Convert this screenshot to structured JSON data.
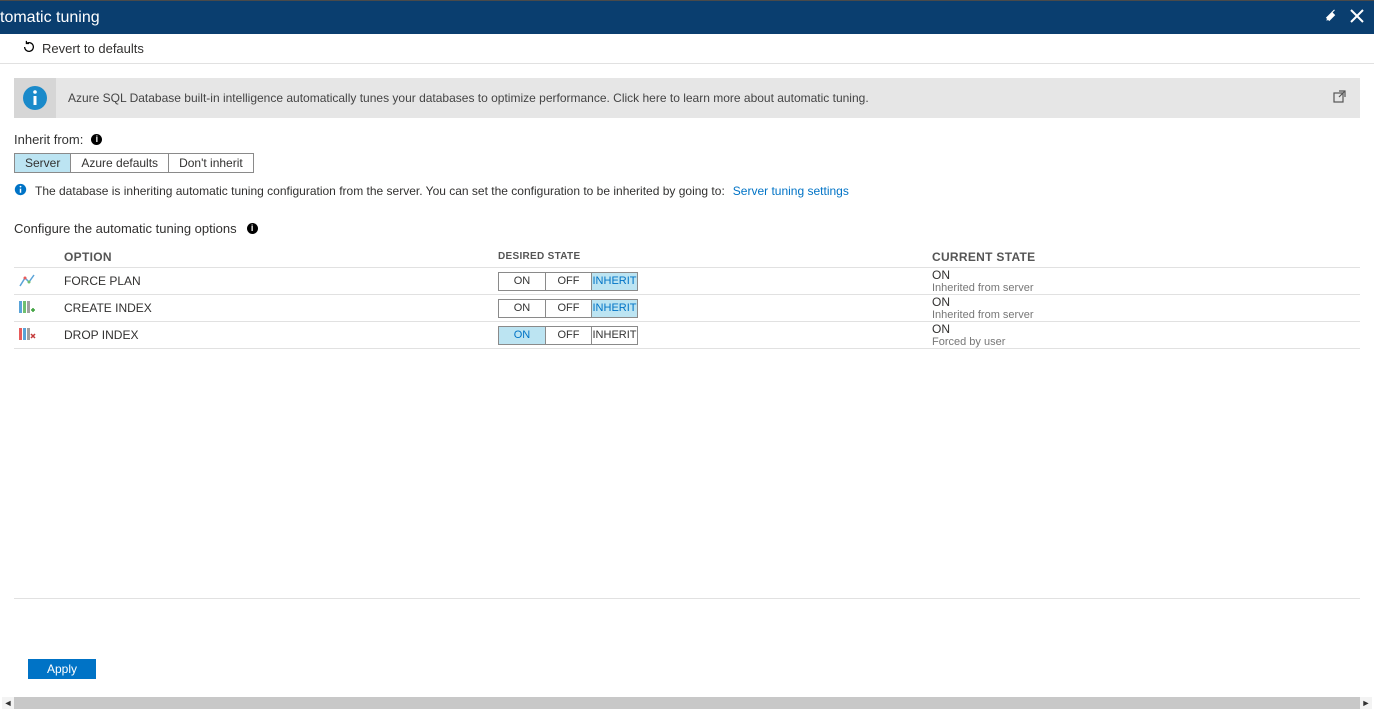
{
  "blade": {
    "title": "tomatic tuning",
    "pin_title": "Pin",
    "close_title": "Close"
  },
  "toolbar": {
    "revert_label": "Revert to defaults"
  },
  "banner": {
    "text": "Azure SQL Database built-in intelligence automatically tunes your databases to optimize performance. Click here to learn more about automatic tuning."
  },
  "inherit": {
    "label": "Inherit from:",
    "options": [
      "Server",
      "Azure defaults",
      "Don't inherit"
    ],
    "selected": "Server"
  },
  "status": {
    "text": "The database is inheriting automatic tuning configuration from the server. You can set the configuration to be inherited by going to:",
    "link": "Server tuning settings"
  },
  "configure_label": "Configure the automatic tuning options",
  "table": {
    "headers": {
      "option": "OPTION",
      "desired": "DESIRED STATE",
      "current": "CURRENT STATE"
    },
    "desired_values": [
      "ON",
      "OFF",
      "INHERIT"
    ],
    "rows": [
      {
        "icon": "force-plan-icon",
        "option": "FORCE PLAN",
        "desired": "INHERIT",
        "current_state": "ON",
        "current_sub": "Inherited from server"
      },
      {
        "icon": "create-index-icon",
        "option": "CREATE INDEX",
        "desired": "INHERIT",
        "current_state": "ON",
        "current_sub": "Inherited from server"
      },
      {
        "icon": "drop-index-icon",
        "option": "DROP INDEX",
        "desired": "ON",
        "current_state": "ON",
        "current_sub": "Forced by user"
      }
    ]
  },
  "apply_label": "Apply",
  "colors": {
    "header_bg": "#0a3e6f",
    "selected_bg": "#bce4f2",
    "link": "#0073c6",
    "primary_btn": "#0073c6"
  }
}
